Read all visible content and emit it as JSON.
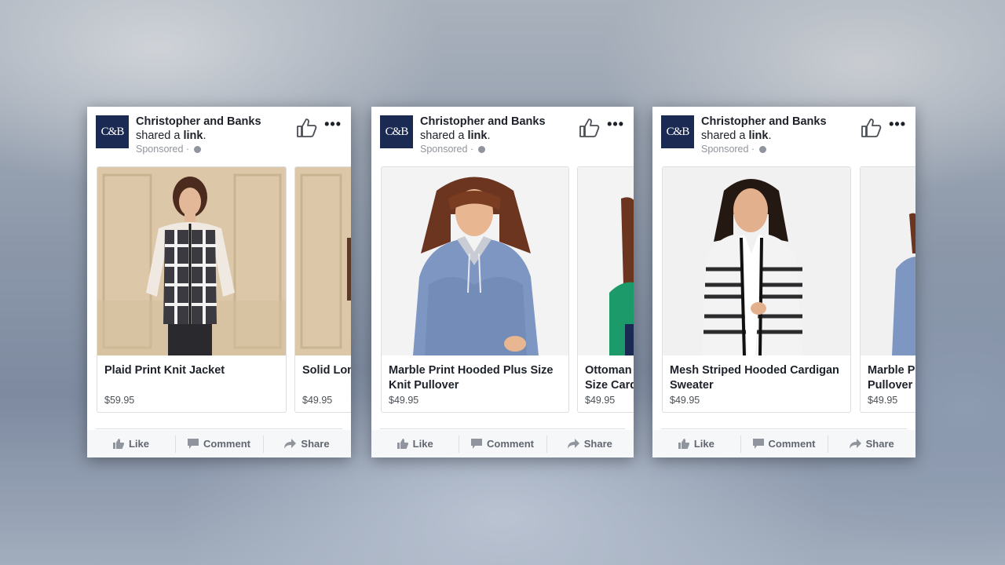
{
  "ads": [
    {
      "brand": "Christopher and Banks",
      "logo_text": "C&B",
      "shared_prefix": "shared a",
      "shared_link": "link",
      "shared_suffix": ".",
      "sponsored": "Sponsored ·",
      "items": [
        {
          "title_line1": "Plaid Print Knit Jacket",
          "title_line2": "",
          "price": "$59.95"
        },
        {
          "title_line1": "Solid Lon",
          "title_line2": "",
          "price": "$49.95"
        }
      ],
      "actions": {
        "like": "Like",
        "comment": "Comment",
        "share": "Share"
      }
    },
    {
      "brand": "Christopher and Banks",
      "logo_text": "C&B",
      "shared_prefix": "shared a",
      "shared_link": "link",
      "shared_suffix": ".",
      "sponsored": "Sponsored ·",
      "items": [
        {
          "title_line1": "Marble Print Hooded Plus Size",
          "title_line2": "Knit Pullover",
          "price": "$49.95"
        },
        {
          "title_line1": "Ottoman",
          "title_line2": "Size Card",
          "price": "$49.95"
        }
      ],
      "actions": {
        "like": "Like",
        "comment": "Comment",
        "share": "Share"
      }
    },
    {
      "brand": "Christopher and Banks",
      "logo_text": "C&B",
      "shared_prefix": "shared a",
      "shared_link": "link",
      "shared_suffix": ".",
      "sponsored": "Sponsored ·",
      "items": [
        {
          "title_line1": "Mesh Striped Hooded Cardigan",
          "title_line2": "Sweater",
          "price": "$49.95"
        },
        {
          "title_line1": "Marble P",
          "title_line2": "Pullover",
          "price": "$49.95"
        }
      ],
      "actions": {
        "like": "Like",
        "comment": "Comment",
        "share": "Share"
      }
    }
  ],
  "colors": {
    "brand_navy": "#1b2a52",
    "text_primary": "#1d2129",
    "text_secondary": "#90949c",
    "action_text": "#606770",
    "action_bg": "#f6f7f9"
  },
  "icons": [
    "thumbs-up-icon",
    "more-options-icon",
    "globe-icon",
    "like-icon",
    "comment-icon",
    "share-icon"
  ]
}
